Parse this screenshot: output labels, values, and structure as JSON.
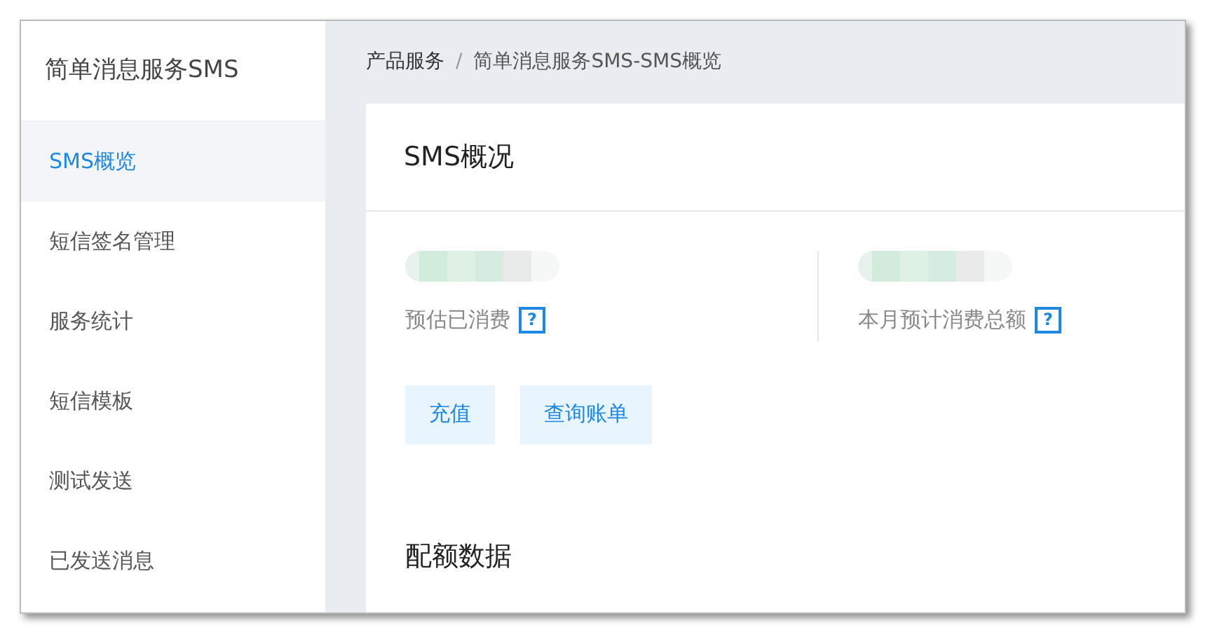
{
  "sidebar": {
    "title": "简单消息服务SMS",
    "items": [
      {
        "label": "SMS概览",
        "selected": true
      },
      {
        "label": "短信签名管理",
        "selected": false
      },
      {
        "label": "服务统计",
        "selected": false
      },
      {
        "label": "短信模板",
        "selected": false
      },
      {
        "label": "测试发送",
        "selected": false
      },
      {
        "label": "已发送消息",
        "selected": false
      }
    ]
  },
  "breadcrumb": {
    "items": [
      "产品服务",
      "简单消息服务SMS-SMS概览"
    ],
    "separator": "/"
  },
  "card": {
    "title": "SMS概况",
    "stats": [
      {
        "label": "预估已消费",
        "help": "?"
      },
      {
        "label": "本月预计消费总额",
        "help": "?"
      }
    ],
    "buttons": [
      "充值",
      "查询账单"
    ],
    "section_title": "配额数据"
  }
}
